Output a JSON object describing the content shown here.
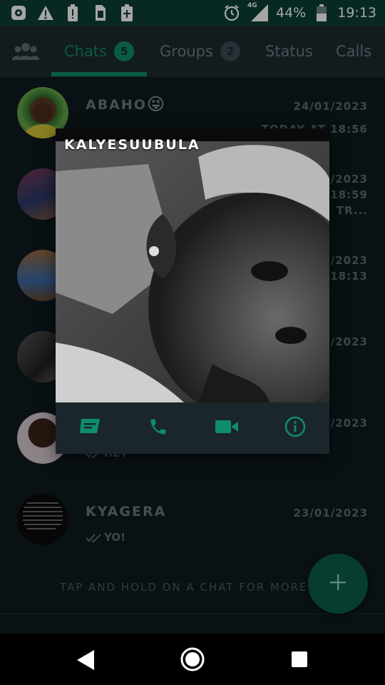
{
  "statusbar": {
    "battery": "44%",
    "time": "19:13",
    "network": "4G"
  },
  "tabs": [
    {
      "label": "Chats",
      "badge": "5",
      "active": true
    },
    {
      "label": "Groups",
      "badge": "2",
      "active": false
    },
    {
      "label": "Status"
    },
    {
      "label": "Calls"
    }
  ],
  "chats": [
    {
      "name": "ABAHO",
      "emoji": "😜",
      "date": "24/01/2023",
      "sub": "TODAY AT 18:56",
      "msg": ""
    },
    {
      "name": "",
      "date": "/2023",
      "sub": "T 18:59",
      "sub2": "TR...",
      "msg": ""
    },
    {
      "name": "",
      "date": "/2023",
      "sub": "E 18:13",
      "msg": ""
    },
    {
      "name": "",
      "date": "/2023",
      "sub": "",
      "msg": ""
    },
    {
      "name": "",
      "date": "/2023",
      "sub": "",
      "msg": "HEY"
    },
    {
      "name": "KYAGERA",
      "date": "23/01/2023",
      "sub": "",
      "msg": "YO!"
    }
  ],
  "hint": "TAP AND HOLD ON A CHAT FOR MORE OPTIO",
  "popup": {
    "title": "KALYESUUBULA",
    "actions": [
      "message-icon",
      "phone-icon",
      "video-icon",
      "info-icon"
    ]
  },
  "colors": {
    "accent": "#0e8c6b",
    "appbar": "#1c2b31",
    "statusbar": "#0b3f35",
    "list_bg": "#0f1b20"
  }
}
